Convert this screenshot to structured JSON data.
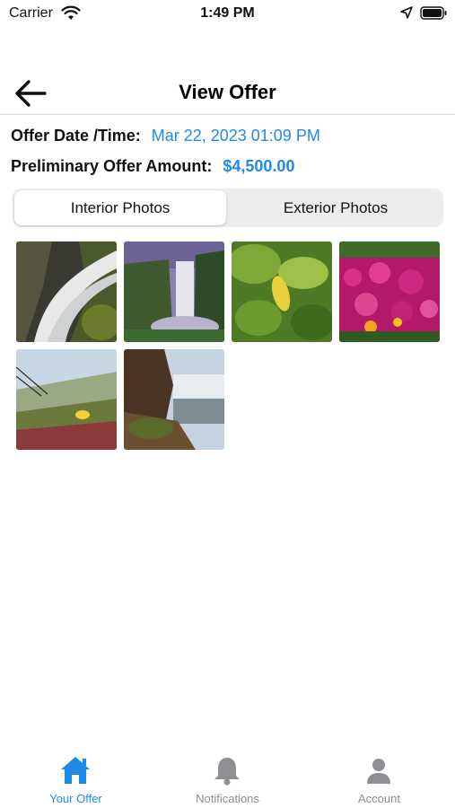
{
  "status_bar": {
    "carrier": "Carrier",
    "time": "1:49 PM",
    "icons": [
      "wifi-icon",
      "location-arrow-icon",
      "battery-icon"
    ]
  },
  "header": {
    "back_icon": "arrow-left-icon",
    "title": "View Offer"
  },
  "offer": {
    "date_label": "Offer Date /Time:",
    "date_value": "Mar 22, 2023 01:09 PM",
    "amount_label": "Preliminary Offer Amount:",
    "amount_value": "$4,500.00"
  },
  "tabs_segment": {
    "items": [
      {
        "label": "Interior Photos",
        "selected": true
      },
      {
        "label": "Exterior Photos",
        "selected": false
      }
    ]
  },
  "photos": [
    {
      "subject": "waterfall-rocks"
    },
    {
      "subject": "waterfall-cliff"
    },
    {
      "subject": "green-leaves"
    },
    {
      "subject": "pink-flowers"
    },
    {
      "subject": "beach-grass"
    },
    {
      "subject": "waterfall-shore"
    }
  ],
  "bottom_tabs": {
    "items": [
      {
        "label": "Your Offer",
        "icon": "home-icon",
        "active": true
      },
      {
        "label": "Notifications",
        "icon": "bell-icon",
        "active": false
      },
      {
        "label": "Account",
        "icon": "person-icon",
        "active": false
      }
    ]
  },
  "colors": {
    "accent": "#1e8ae8",
    "inactive_tab": "#8e8e93",
    "segment_bg": "#ececee"
  }
}
